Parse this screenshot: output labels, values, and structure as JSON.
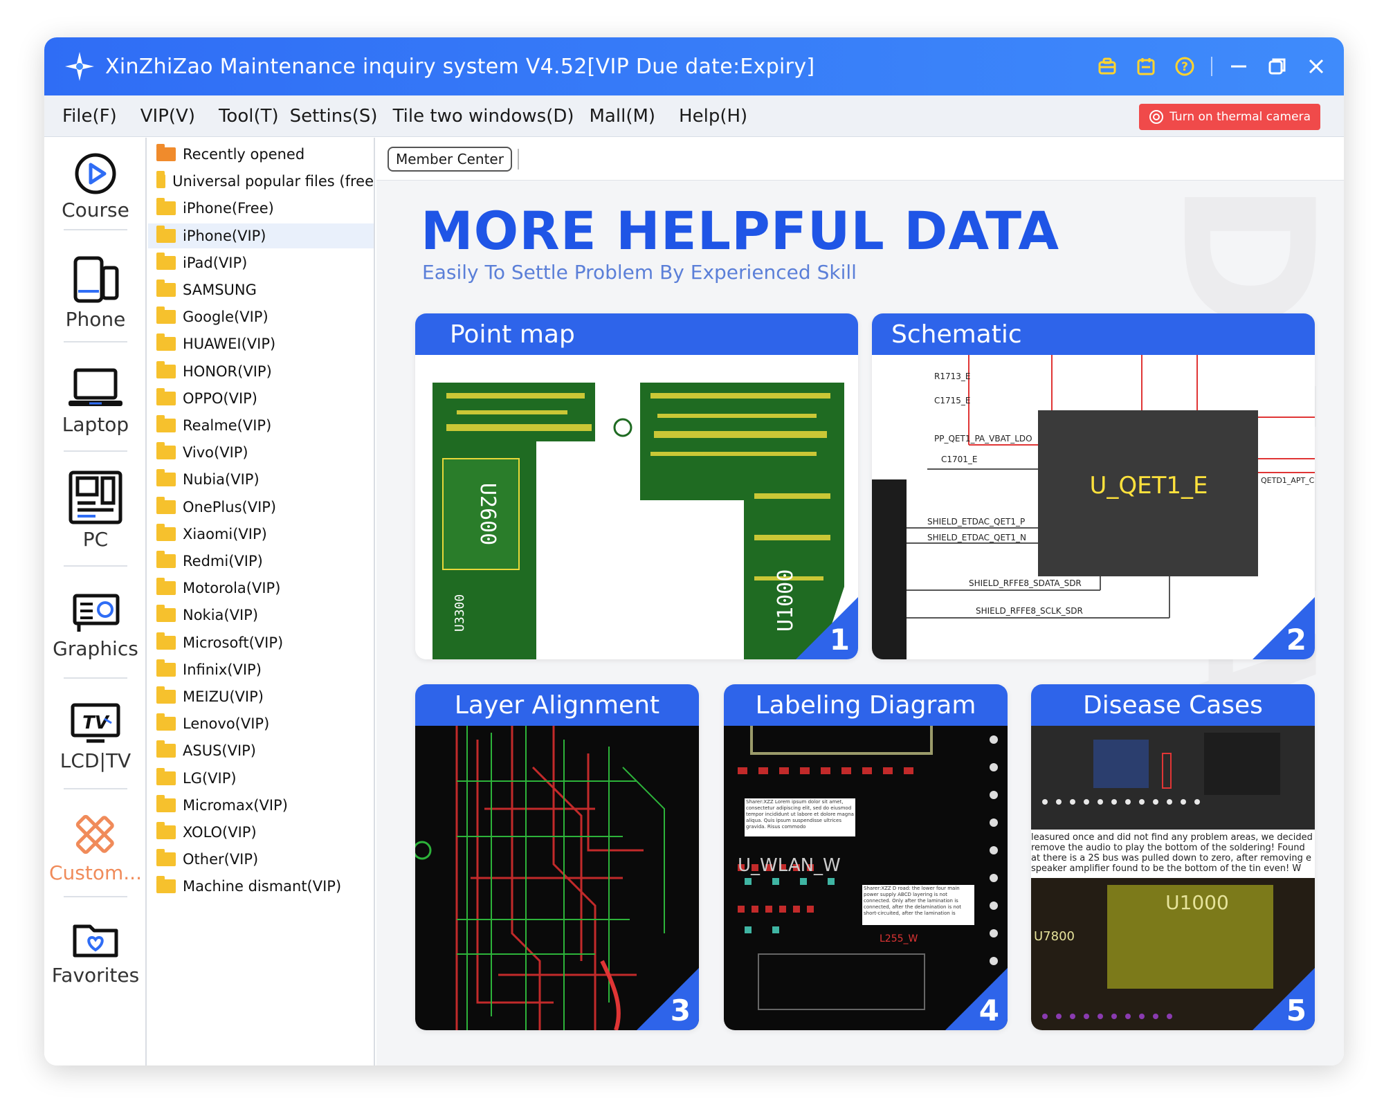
{
  "window": {
    "title": "XinZhiZao Maintenance inquiry system V4.52[VIP Due date:Expiry]",
    "accent": "#2f6df5"
  },
  "titlebar_icons": [
    "briefcase-icon",
    "calendar-icon",
    "help-icon",
    "minimize-icon",
    "restore-icon",
    "close-icon"
  ],
  "menu": {
    "items": [
      "File(F)",
      "VIP(V)",
      "Tool(T)",
      "Settins(S)",
      "Tile two windows(D)",
      "Mall(M)",
      "Help(H)"
    ],
    "thermal_button": "Turn on thermal camera"
  },
  "leftnav": {
    "items": [
      {
        "label": "Course",
        "icon": "play-circle-icon"
      },
      {
        "label": "Phone",
        "icon": "phone-icon"
      },
      {
        "label": "Laptop",
        "icon": "laptop-icon"
      },
      {
        "label": "PC",
        "icon": "motherboard-icon"
      },
      {
        "label": "Graphics",
        "icon": "graphics-card-icon"
      },
      {
        "label": "LCD|TV",
        "icon": "tv-icon"
      },
      {
        "label": "Custom...",
        "icon": "custom-tools-icon"
      },
      {
        "label": "Favorites",
        "icon": "favorites-folder-icon"
      }
    ]
  },
  "tree": {
    "items": [
      "Recently opened",
      "Universal popular files (free",
      "iPhone(Free)",
      "iPhone(VIP)",
      "iPad(VIP)",
      "SAMSUNG",
      "Google(VIP)",
      "HUAWEI(VIP)",
      "HONOR(VIP)",
      "OPPO(VIP)",
      "Realme(VIP)",
      "Vivo(VIP)",
      "Nubia(VIP)",
      "OnePlus(VIP)",
      "Xiaomi(VIP)",
      "Redmi(VIP)",
      "Motorola(VIP)",
      "Nokia(VIP)",
      "Microsoft(VIP)",
      "Infinix(VIP)",
      "MEIZU(VIP)",
      "Lenovo(VIP)",
      "ASUS(VIP)",
      "LG(VIP)",
      "Micromax(VIP)",
      "XOLO(VIP)",
      "Other(VIP)",
      "Machine dismant(VIP)"
    ],
    "selected": "iPhone(VIP)"
  },
  "toolbar": {
    "member_center": "Member Center"
  },
  "banner": {
    "headline": "MORE HELPFUL DATA",
    "subline": "Easily To Settle Problem By Experienced Skill",
    "cards": [
      {
        "title": "Point map",
        "num": "1"
      },
      {
        "title": "Schematic",
        "num": "2"
      },
      {
        "title": "Layer Alignment",
        "num": "3"
      },
      {
        "title": "Labeling Diagram",
        "num": "4"
      },
      {
        "title": "Disease Cases",
        "num": "5"
      }
    ],
    "schematic": {
      "chip": "U_QET1_E",
      "labels": [
        "R1713_E",
        "C1715_E",
        "PP_QET1_PA_VBAT_LDO",
        "C1701_E",
        "SHIELD_ETDAC_QET1_P",
        "SHIELD_ETDAC_QET1_N",
        "SHIELD_RFFE8_SDATA_SDR",
        "SHIELD_RFFE8_SCLK_SDR",
        "QETD1_APT_C"
      ]
    },
    "disease_text": "leasured once and did not find any problem areas, we decided remove the audio to play the bottom of the soldering! Found at there is a 2S bus was pulled down to zero, after removing e speaker amplifier found to be the bottom of the tin even! W",
    "disease_chip": "U1000",
    "disease_chip2": "U7800",
    "label_chip": "U_WLAN_W",
    "label_chip2": "L255_W",
    "pointmap_chip": "U2600",
    "pointmap_chip2": "U3300",
    "pointmap_chip3": "U1000",
    "label_note1": "Sharer:XZZ Lorem ipsum dolor sit amet, consectetur adipiscing elit, sed do eiusmod tempor incididunt ut labore et dolore magna aliqua. Quis ipsum suspendisse ultrices gravida. Risus commodo",
    "label_note2": "Sharer:XZZ D road: the lower four main power supply ABCD layering is not connected. Only after the lamination is connected, after the delamination is not short-circuited, after the lamination is"
  }
}
